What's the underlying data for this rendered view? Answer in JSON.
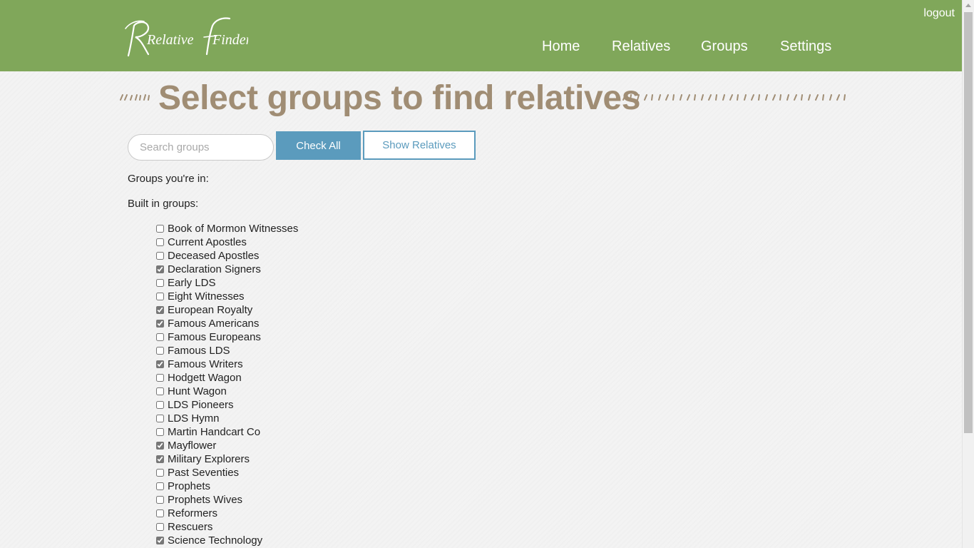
{
  "header": {
    "logo": {
      "word1": "Relative",
      "word2": "Finder"
    },
    "logout_label": "logout",
    "nav": [
      {
        "label": "Home"
      },
      {
        "label": "Relatives"
      },
      {
        "label": "Groups"
      },
      {
        "label": "Settings"
      }
    ],
    "background_color": "#80a75a"
  },
  "main": {
    "title": "Select groups to find relatives",
    "search": {
      "placeholder": "Search groups",
      "value": ""
    },
    "check_all_label": "Check All",
    "show_relatives_label": "Show Relatives",
    "groups_youre_in_label": "Groups you're in:",
    "built_in_groups_label": "Built in groups:",
    "groups": [
      {
        "label": "Book of Mormon Witnesses",
        "checked": false
      },
      {
        "label": "Current Apostles",
        "checked": false
      },
      {
        "label": "Deceased Apostles",
        "checked": false
      },
      {
        "label": "Declaration Signers",
        "checked": true
      },
      {
        "label": "Early LDS",
        "checked": false
      },
      {
        "label": "Eight Witnesses",
        "checked": false
      },
      {
        "label": "European Royalty",
        "checked": true
      },
      {
        "label": "Famous Americans",
        "checked": true
      },
      {
        "label": "Famous Europeans",
        "checked": false
      },
      {
        "label": "Famous LDS",
        "checked": false
      },
      {
        "label": "Famous Writers",
        "checked": true
      },
      {
        "label": "Hodgett Wagon",
        "checked": false
      },
      {
        "label": "Hunt Wagon",
        "checked": false
      },
      {
        "label": "LDS Pioneers",
        "checked": false
      },
      {
        "label": "LDS Hymn",
        "checked": false
      },
      {
        "label": "Martin Handcart Co",
        "checked": false
      },
      {
        "label": "Mayflower",
        "checked": true
      },
      {
        "label": "Military Explorers",
        "checked": true
      },
      {
        "label": "Past Seventies",
        "checked": false
      },
      {
        "label": "Prophets",
        "checked": false
      },
      {
        "label": "Prophets Wives",
        "checked": false
      },
      {
        "label": "Reformers",
        "checked": false
      },
      {
        "label": "Rescuers",
        "checked": false
      },
      {
        "label": "Science Technology",
        "checked": true
      }
    ],
    "colors": {
      "title": "#a08d74",
      "button_primary": "#5b9bbd"
    }
  }
}
